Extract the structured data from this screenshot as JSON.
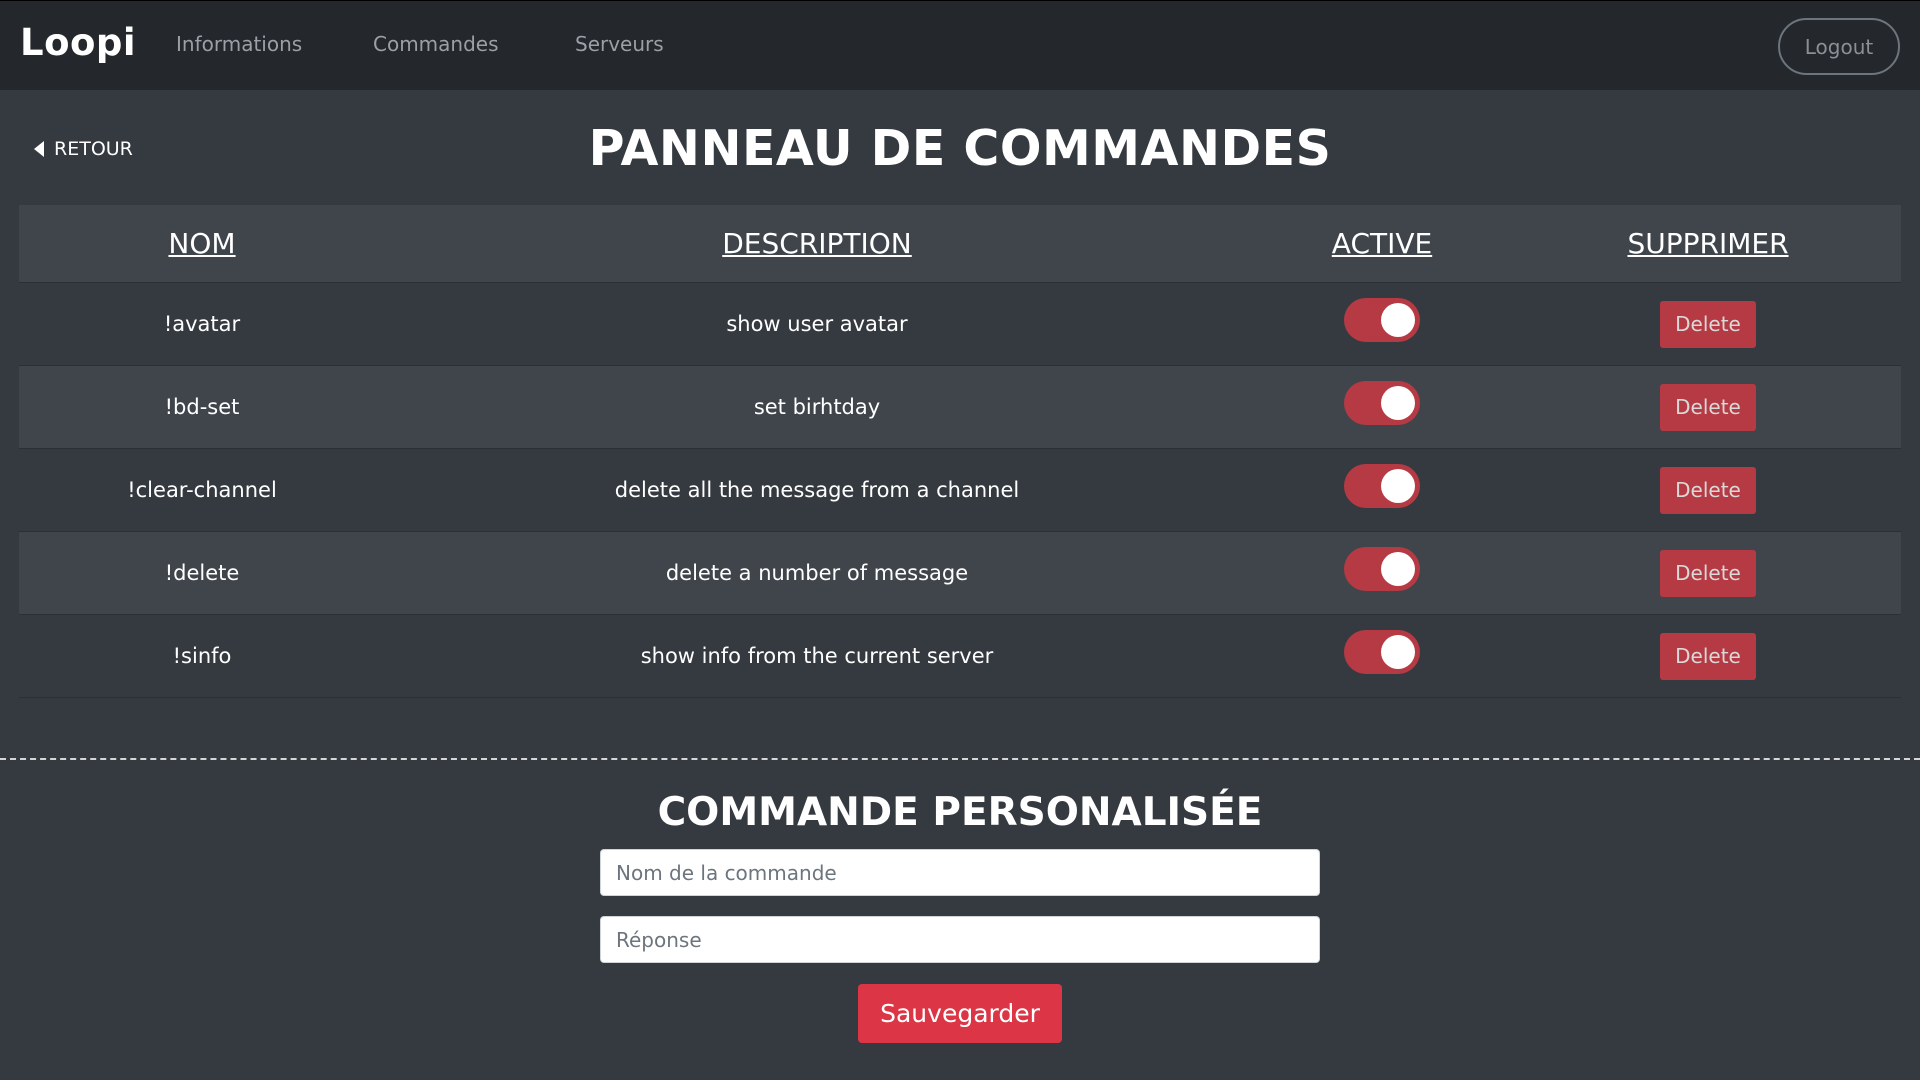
{
  "navbar": {
    "brand": "Loopi",
    "links": [
      "Informations",
      "Commandes",
      "Serveurs"
    ],
    "logout_label": "Logout"
  },
  "header": {
    "back_label": "RETOUR",
    "title": "PANNEAU DE COMMANDES"
  },
  "table": {
    "columns": [
      "NOM",
      "DESCRIPTION",
      "ACTIVE",
      "SUPPRIMER"
    ],
    "rows": [
      {
        "name": "!avatar",
        "description": "show user avatar",
        "active": true,
        "delete_label": "Delete"
      },
      {
        "name": "!bd-set",
        "description": "set birhtday",
        "active": true,
        "delete_label": "Delete"
      },
      {
        "name": "!clear-channel",
        "description": "delete all the message from a channel",
        "active": true,
        "delete_label": "Delete"
      },
      {
        "name": "!delete",
        "description": "delete a number of message",
        "active": true,
        "delete_label": "Delete"
      },
      {
        "name": "!sinfo",
        "description": "show info from the current server",
        "active": true,
        "delete_label": "Delete"
      }
    ]
  },
  "custom": {
    "title": "COMMANDE PERSONALISÉE",
    "name_placeholder": "Nom de la commande",
    "response_placeholder": "Réponse",
    "save_label": "Sauvegarder"
  },
  "colors": {
    "navbar_bg": "#24272c",
    "page_bg": "#343a40",
    "accent_red": "#dc3545",
    "toggle_red": "#b63a44"
  }
}
